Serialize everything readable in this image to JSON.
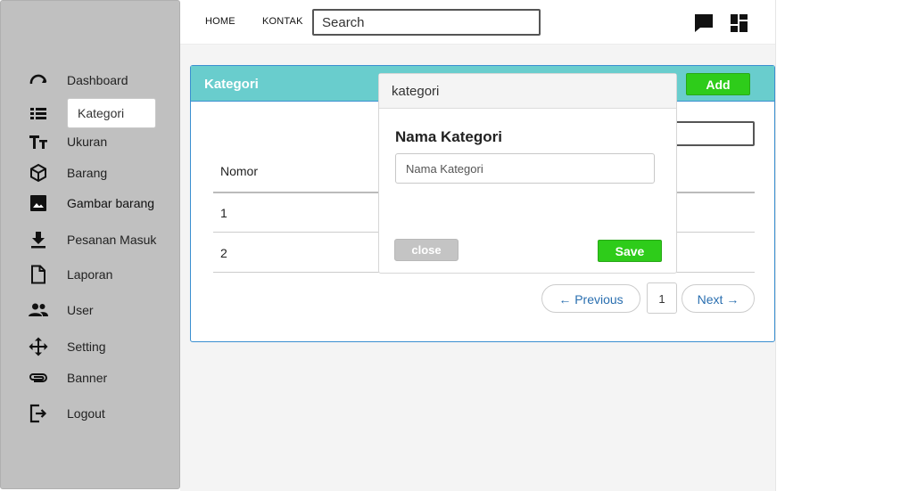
{
  "sidebar": {
    "items": [
      {
        "label": "Dashboard",
        "icon": "dashboard-gauge-icon"
      },
      {
        "label": "Kategori",
        "icon": "list-icon",
        "active": true
      },
      {
        "label": "Ukuran",
        "icon": "text-size-icon"
      },
      {
        "label": "Barang",
        "icon": "box-icon"
      },
      {
        "label": "Gambar barang",
        "icon": "image-icon"
      },
      {
        "label": "Pesanan Masuk",
        "icon": "download-icon"
      },
      {
        "label": "Laporan",
        "icon": "document-icon"
      },
      {
        "label": "User",
        "icon": "users-icon"
      },
      {
        "label": "Setting",
        "icon": "move-arrows-icon"
      },
      {
        "label": "Banner",
        "icon": "paperclip-icon"
      },
      {
        "label": "Logout",
        "icon": "logout-icon"
      }
    ]
  },
  "topbar": {
    "home": "HOME",
    "kontak": "KONTAK",
    "search_value": "Search",
    "icons": [
      "chat-icon",
      "dashboard-grid-icon"
    ]
  },
  "panel": {
    "title": "Kategori",
    "add_label": "Add",
    "header_color": "#69cdcd",
    "columns": [
      "Nomor"
    ],
    "rows": [
      {
        "nomor": "1"
      },
      {
        "nomor": "2"
      }
    ],
    "pagination": {
      "previous": "← Previous",
      "page": "1",
      "next": "Next →"
    }
  },
  "modal": {
    "title": "kategori",
    "field_label": "Nama Kategori",
    "field_placeholder": "Nama Kategori",
    "close_label": "close",
    "save_label": "Save"
  },
  "colors": {
    "accent_green": "#2ecc1a",
    "sidebar_bg": "#c0c0c0",
    "link_blue": "#2a6fb0"
  }
}
